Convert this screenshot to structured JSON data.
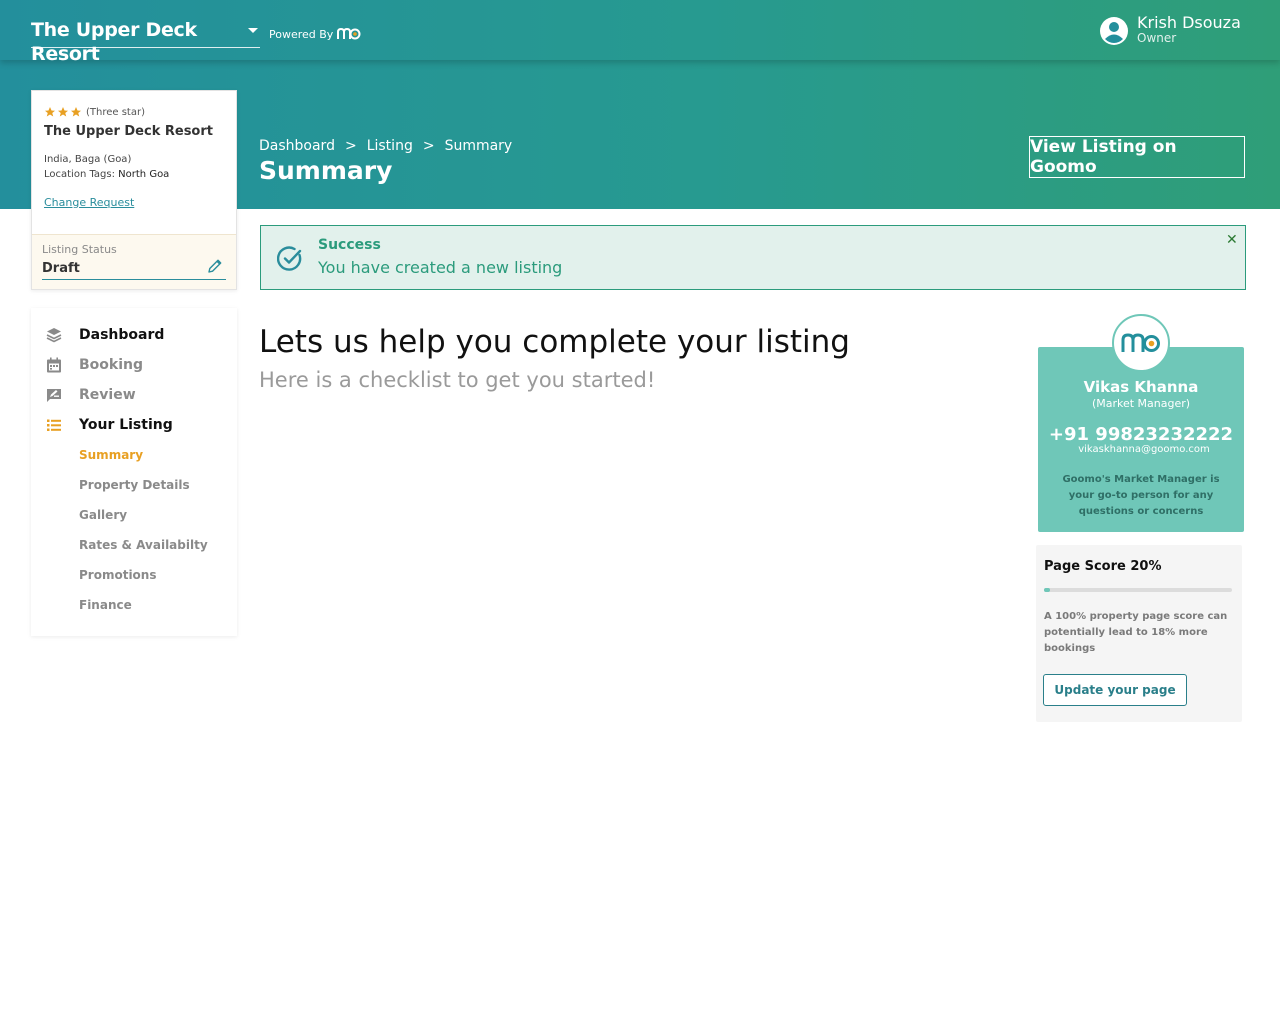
{
  "header": {
    "property_name": "The Upper Deck Resort",
    "powered_by": "Powered By",
    "user": {
      "name": "Krish Dsouza",
      "role": "Owner"
    }
  },
  "breadcrumb": [
    "Dashboard",
    "Listing",
    "Summary"
  ],
  "breadcrumb_sep": ">",
  "page_title": "Summary",
  "view_listing_label": "View Listing on Goomo",
  "property_card": {
    "stars": 3,
    "star_label": "(Three star)",
    "name": "The Upper Deck Resort",
    "location": "India, Baga (Goa)",
    "location_tags_label": "Location Tags:",
    "location_tags_value": "North Goa",
    "change_request": "Change Request",
    "listing_status_label": "Listing Status",
    "listing_status_value": "Draft"
  },
  "menu": {
    "items": [
      {
        "label": "Dashboard",
        "icon": "layers-icon"
      },
      {
        "label": "Booking",
        "icon": "calendar-icon"
      },
      {
        "label": "Review",
        "icon": "review-icon"
      },
      {
        "label": "Your Listing",
        "icon": "list-icon"
      }
    ],
    "sub_items": [
      "Summary",
      "Property Details",
      "Gallery",
      "Rates & Availabilty",
      "Promotions",
      "Finance"
    ],
    "active_sub": "Summary"
  },
  "alert": {
    "title": "Success",
    "message": "You have created a new listing",
    "close": "✕"
  },
  "main": {
    "heading": "Lets us help you complete your listing",
    "subheading": "Here is a checklist to get you started!"
  },
  "manager": {
    "name": "Vikas Khanna",
    "role": "(Market Manager)",
    "phone": "+91 99823232222",
    "email": "vikaskhanna@goomo.com",
    "description": "Goomo's Market Manager is your go-to person for any questions or concerns"
  },
  "page_score": {
    "title": "Page Score 20%",
    "value_percent": 20,
    "description": "A 100% property page score can potentially lead to 18% more bookings",
    "button": "Update your page"
  },
  "colors": {
    "teal": "#238f9c",
    "green": "#2f9e78",
    "accent_orange": "#e8a023",
    "success_green": "#2b9b7c",
    "manager_card": "#6fc7b8"
  }
}
